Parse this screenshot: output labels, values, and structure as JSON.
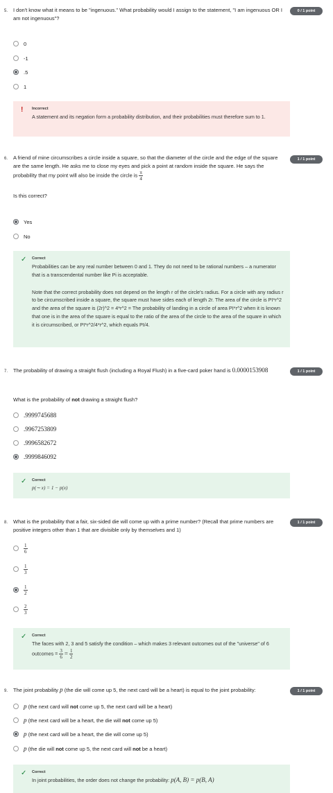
{
  "q5": {
    "number": "5.",
    "text": "I don't know what it means to be \"ingenuous.\" What probability would I assign to the statement, \"I am ingenuous OR I am not ingenuous\"?",
    "points": "0 / 1 point",
    "options": [
      "0",
      "-1",
      ".5",
      "1"
    ],
    "selected_index": 2,
    "feedback_title": "Incorrect",
    "feedback_text": "A statement and its negation form a probability distribution, and their probabilities must therefore sum to 1."
  },
  "q6": {
    "number": "6.",
    "text": "A friend of mine circumscribes a circle inside a square, so that the diameter of the circle and the edge of the square are the same length. He asks me to close my eyes and pick a point at random inside the square. He says the probability that my point will also be inside the circle is",
    "frac_num": "π",
    "frac_den": "4",
    "points": "1 / 1 point",
    "subquestion": "Is this correct?",
    "options": [
      "Yes",
      "No"
    ],
    "selected_index": 0,
    "feedback_title": "Correct",
    "feedback_p1": "Probabilities can be any real number between 0 and 1. They do not need to be rational numbers – a numerator that is a transcendental number like Pi is acceptable.",
    "feedback_p2": "Note that the correct probability does not depend on the length r of the circle's radius. For a circle with any radius r to be circumscribed inside a square, the square must have sides each of length 2r. The area of the circle is PI*r^2 and the area of the square is (2r)^2 = 4*r^2 = The probability of landing in a circle of area PI*r^2 when it is known that one is in the area of the square is equal to the ratio of the area of the circle to the area of the square in which it is circumscribed, or PI*r^2/4*r^2, which equals PI/4."
  },
  "q7": {
    "number": "7.",
    "text": "The probability of drawing a straight flush (including a Royal Flush) in a five-card poker hand is",
    "value": "0.0000153908",
    "points": "1 / 1 point",
    "sub_pre": "What is the probability of",
    "sub_bold": "not",
    "sub_post": "drawing a straight flush?",
    "options": [
      ".9999745688",
      ".9967253809",
      ".9996582672",
      ".9999846092"
    ],
    "selected_index": 3,
    "feedback_title": "Correct",
    "feedback_math": "p(∼ x) = 1 − p(x)"
  },
  "q8": {
    "number": "8.",
    "text": "What is the probability that a fair, six-sided die will come up with a prime number? (Recall that prime numbers are positive integers other than 1 that are divisible only by themselves and 1)",
    "points": "1 / 1 point",
    "options": [
      {
        "num": "1",
        "den": "6"
      },
      {
        "num": "1",
        "den": "3"
      },
      {
        "num": "1",
        "den": "2"
      },
      {
        "num": "2",
        "den": "3"
      }
    ],
    "selected_index": 2,
    "feedback_title": "Correct",
    "feedback_text": "The faces with 2, 3 and 5 satisfy the condition – which makes 3 relevant outcomes out of the \"universe\" of 6 outcomes =",
    "f1_num": "3",
    "f1_den": "6",
    "f2_num": "1",
    "f2_den": "2"
  },
  "q9": {
    "number": "9.",
    "text": "The joint probability",
    "text_post": "(the die will come up 5, the next card will be a heart) is equal to the joint probability:",
    "p_symbol": "p",
    "points": "1 / 1 point",
    "options": [
      {
        "pre": "(the next card will",
        "bold": "not",
        "post": "come up 5, the next card will be a heart)"
      },
      {
        "pre": "(the next card will be a heart, the die will",
        "bold": "not",
        "post": "come up 5)"
      },
      {
        "pre": "(the next card will be a heart, the die will come up 5)",
        "bold": "",
        "post": ""
      },
      {
        "pre": "(the die will",
        "bold": "not",
        "post": "come up 5, the next card will",
        "bold2": "not",
        "post2": "be a heart)"
      }
    ],
    "selected_index": 2,
    "feedback_title": "Correct",
    "feedback_text": "In joint probabilities, the order does not change the probability:",
    "feedback_math": "p(A, B) = p(B, A)"
  }
}
